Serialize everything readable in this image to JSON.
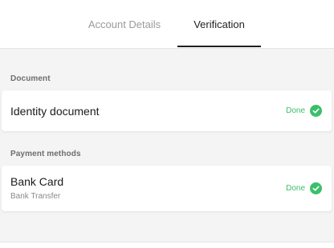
{
  "tabs": {
    "account_details": "Account Details",
    "verification": "Verification",
    "active": "Verification"
  },
  "document_section": {
    "label": "Document",
    "item": {
      "title": "Identity document",
      "status": "Done"
    }
  },
  "payment_section": {
    "label": "Payment methods",
    "item": {
      "title": "Bank Card",
      "subtitle": "Bank Transfer",
      "status": "Done"
    }
  },
  "colors": {
    "success": "#3bbf6a",
    "active_tab": "#1f1f1f",
    "inactive_tab": "#9b9b9b",
    "background": "#f4f4f4"
  },
  "icons": {
    "status_done": "check-circle-icon"
  }
}
